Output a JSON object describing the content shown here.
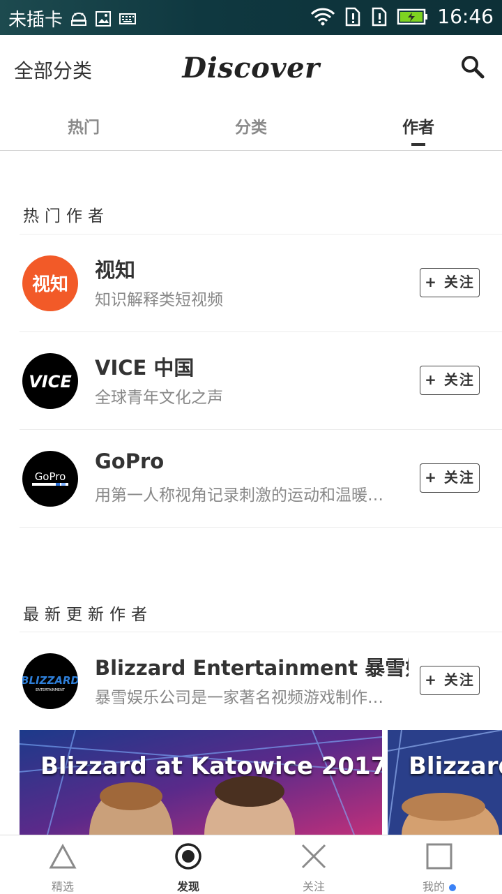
{
  "status_bar": {
    "carrier": "未插卡",
    "time": "16:46"
  },
  "header": {
    "left_label": "全部分类",
    "title": "Discover"
  },
  "tabs": [
    {
      "label": "热门",
      "active": false
    },
    {
      "label": "分类",
      "active": false
    },
    {
      "label": "作者",
      "active": true
    }
  ],
  "sections": {
    "hot_title": "热门作者",
    "latest_title": "最新更新作者"
  },
  "follow_label": "+ 关注",
  "hot_authors": [
    {
      "name": "视知",
      "desc": "知识解释类短视频",
      "avatar_text": "视知",
      "avatar_bg": "#f25a28"
    },
    {
      "name": "VICE 中国",
      "desc": "全球青年文化之声",
      "avatar_text": "VICE",
      "avatar_bg": "#000000"
    },
    {
      "name": "GoPro",
      "desc": "用第一人称视角记录刺激的运动和温暖的瞬间",
      "avatar_text": "GoPro",
      "avatar_bg": "#000000"
    }
  ],
  "latest_authors": [
    {
      "name": "Blizzard Entertainment 暴雪娱乐",
      "desc": "暴雪娱乐公司是一家著名视频游戏制作和发行公司",
      "avatar_text": "BLIZZARD",
      "avatar_sub": "ENTERTAINMENT",
      "avatar_bg": "#000000"
    }
  ],
  "videos": [
    {
      "title": "Blizzard at Katowice 2017"
    },
    {
      "title": "Blizzard"
    }
  ],
  "bottom_nav": [
    {
      "label": "精选",
      "icon": "triangle-icon",
      "active": false
    },
    {
      "label": "发现",
      "icon": "circle-icon",
      "active": true
    },
    {
      "label": "关注",
      "icon": "x-icon",
      "active": false
    },
    {
      "label": "我的",
      "icon": "square-icon",
      "active": false,
      "dot_color": "#3b82f6"
    }
  ]
}
